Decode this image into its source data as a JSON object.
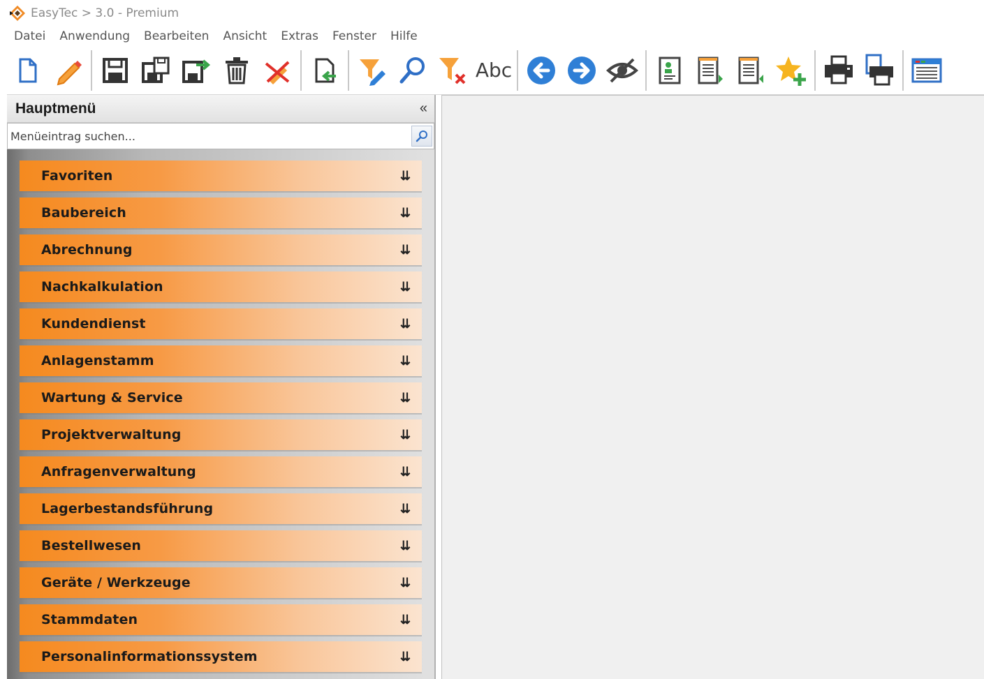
{
  "window": {
    "title": "EasyTec > 3.0 - Premium"
  },
  "menubar": {
    "items": [
      "Datei",
      "Anwendung",
      "Bearbeiten",
      "Ansicht",
      "Extras",
      "Fenster",
      "Hilfe"
    ]
  },
  "toolbar": {
    "spellcheck_label": "Abc",
    "icons": [
      "new-document-icon",
      "edit-pencil-icon",
      "save-icon",
      "save-copy-icon",
      "export-icon",
      "delete-icon",
      "cancel-edit-icon",
      "import-document-icon",
      "filter-edit-icon",
      "search-icon",
      "filter-clear-icon",
      "spellcheck-icon",
      "back-icon",
      "forward-icon",
      "hide-icon",
      "contact-card-icon",
      "report-next-icon",
      "report-prev-icon",
      "add-favorite-icon",
      "print-icon",
      "print-preview-icon",
      "layout-icon"
    ]
  },
  "sidebar": {
    "title": "Hauptmenü",
    "collapse_label": "«",
    "search_placeholder": "Menüeintrag suchen...",
    "groups": [
      "Favoriten",
      "Baubereich",
      "Abrechnung",
      "Nachkalkulation",
      "Kundendienst",
      "Anlagenstamm",
      "Wartung & Service",
      "Projektverwaltung",
      "Anfragenverwaltung",
      "Lagerbestandsführung",
      "Bestellwesen",
      "Geräte / Werkzeuge",
      "Stammdaten",
      "Personalinformationssystem"
    ],
    "chevron": "»"
  },
  "colors": {
    "accent_orange": "#f58a1f",
    "toolbar_blue": "#2f7fd6",
    "sidebar_gray": "#9a9a9a"
  }
}
